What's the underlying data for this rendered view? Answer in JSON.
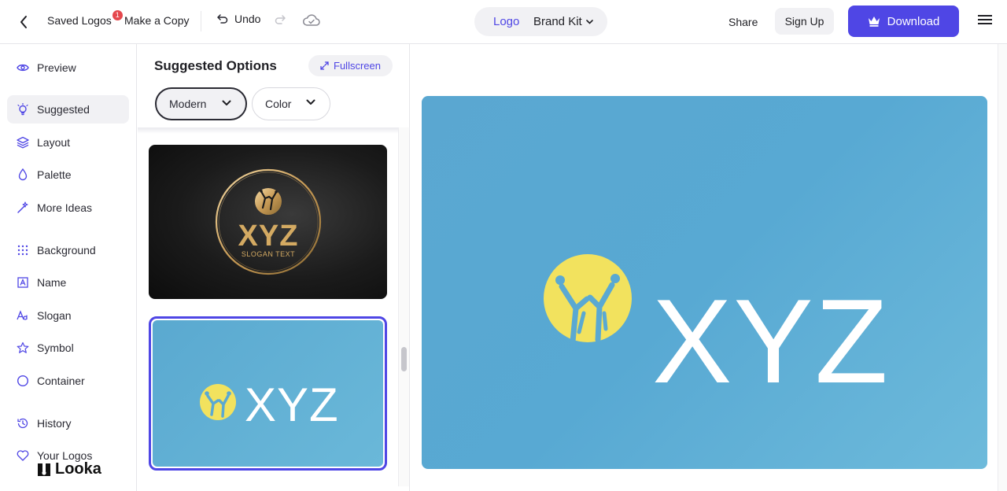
{
  "topbar": {
    "saved_logos_label": "Saved Logos",
    "saved_badge": "1",
    "make_copy_label": "Make a Copy",
    "undo_label": "Undo",
    "toggle": {
      "logo_label": "Logo",
      "brand_kit_label": "Brand Kit"
    },
    "share_label": "Share",
    "signup_label": "Sign Up",
    "download_label": "Download",
    "accent_color": "#4f46e5"
  },
  "sidebar": {
    "items": [
      {
        "label": "Preview",
        "icon": "eye-icon"
      },
      {
        "label": "Suggested",
        "icon": "lightbulb-icon",
        "active": true
      },
      {
        "label": "Layout",
        "icon": "layers-icon"
      },
      {
        "label": "Palette",
        "icon": "droplet-icon"
      },
      {
        "label": "More Ideas",
        "icon": "magic-wand-icon"
      },
      {
        "label": "Background",
        "icon": "grid-dots-icon"
      },
      {
        "label": "Name",
        "icon": "text-box-icon"
      },
      {
        "label": "Slogan",
        "icon": "font-icon"
      },
      {
        "label": "Symbol",
        "icon": "star-icon"
      },
      {
        "label": "Container",
        "icon": "circle-icon"
      },
      {
        "label": "History",
        "icon": "history-icon"
      },
      {
        "label": "Your Logos",
        "icon": "heart-icon"
      }
    ],
    "brand_name": "Looka"
  },
  "panel": {
    "title": "Suggested Options",
    "fullscreen_label": "Fullscreen",
    "filters": [
      {
        "label": "Modern",
        "selected": true
      },
      {
        "label": "Color",
        "selected": false
      }
    ],
    "thumbnails": [
      {
        "text": "XYZ",
        "slogan": "SLOGAN TEXT",
        "style": "dark-gold",
        "selected": false
      },
      {
        "text": "XYZ",
        "style": "blue-yellow",
        "selected": true
      }
    ]
  },
  "canvas": {
    "logo_text": "XYZ",
    "background_color": "#5aa9d2",
    "symbol_color": "#f2e25e"
  }
}
